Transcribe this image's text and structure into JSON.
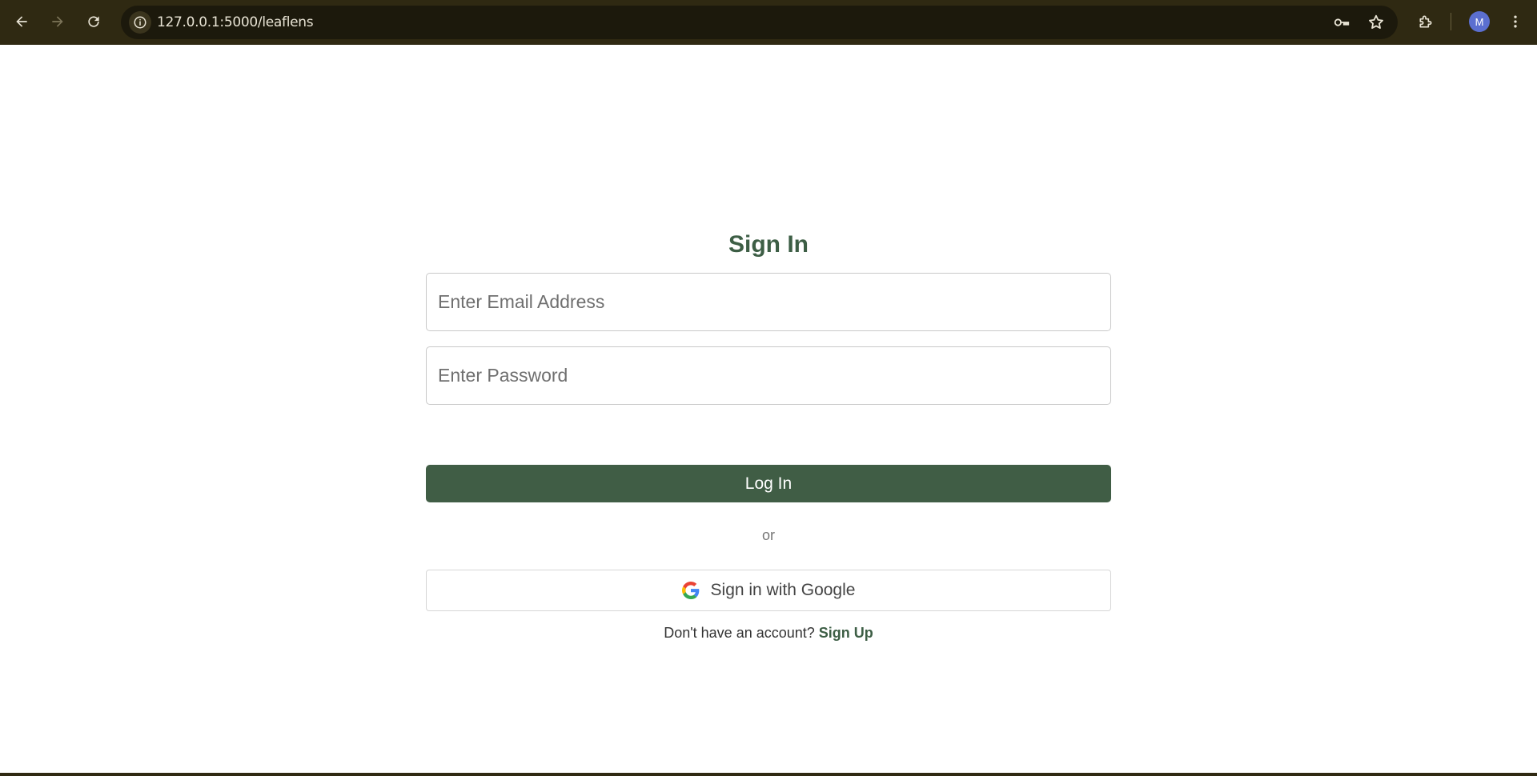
{
  "browser": {
    "url": "127.0.0.1:5000/leaflens",
    "profile_initial": "M",
    "icons": [
      "back-icon",
      "forward-icon",
      "reload-icon",
      "site-info-icon",
      "password-key-icon",
      "bookmark-star-icon",
      "extensions-icon",
      "menu-icon"
    ]
  },
  "signin": {
    "title": "Sign In",
    "email_placeholder": "Enter Email Address",
    "password_placeholder": "Enter Password",
    "login_label": "Log In",
    "or_label": "or",
    "google_label": "Sign in with Google",
    "no_account_text": "Don't have an account?",
    "signup_label": "Sign Up"
  },
  "colors": {
    "chrome_bg": "#2f2912",
    "accent_green": "#405d45",
    "title_green": "#3d5e45"
  }
}
